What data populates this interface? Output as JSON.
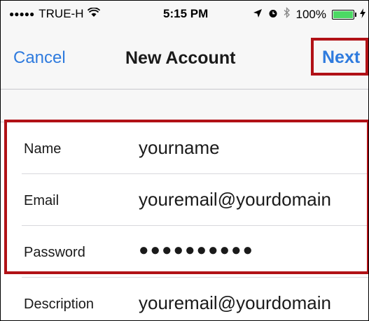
{
  "status_bar": {
    "signal": "●●●●●",
    "carrier": "TRUE-H",
    "wifi_icon": "wifi-icon",
    "time": "5:15 PM",
    "location_icon": "location-arrow-icon",
    "alarm_icon": "alarm-icon",
    "bluetooth_icon": "bluetooth-icon",
    "battery_percent": "100%",
    "battery_level": 1.0,
    "charging_icon": "charging-bolt-icon"
  },
  "nav": {
    "cancel_label": "Cancel",
    "title": "New Account",
    "next_label": "Next"
  },
  "form": {
    "fields": [
      {
        "label": "Name",
        "value": "yourname"
      },
      {
        "label": "Email",
        "value": "youremail@yourdomain"
      },
      {
        "label": "Password",
        "value": "●●●●●●●●●●"
      },
      {
        "label": "Description",
        "value": "youremail@yourdomain"
      }
    ]
  },
  "colors": {
    "accent": "#2f7bde",
    "highlight": "#b11116",
    "battery": "#4cd964"
  }
}
